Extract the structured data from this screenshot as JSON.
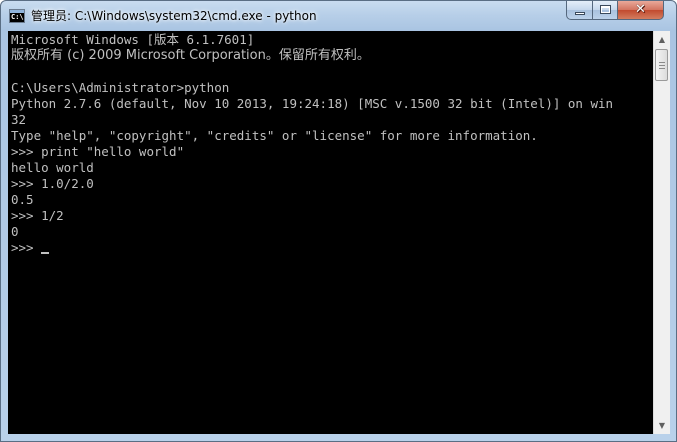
{
  "window": {
    "title": "管理员: C:\\Windows\\system32\\cmd.exe - python",
    "app_icon_text": "C:\\"
  },
  "caption_buttons": {
    "close_glyph": "✕"
  },
  "console": {
    "lines": [
      "Microsoft Windows [版本 6.1.7601]",
      "版权所有 (c) 2009 Microsoft Corporation。保留所有权利。",
      "",
      "C:\\Users\\Administrator>python",
      "Python 2.7.6 (default, Nov 10 2013, 19:24:18) [MSC v.1500 32 bit (Intel)] on win",
      "32",
      "Type \"help\", \"copyright\", \"credits\" or \"license\" for more information.",
      ">>> print \"hello world\"",
      "hello world",
      ">>> 1.0/2.0",
      "0.5",
      ">>> 1/2",
      "0",
      ">>> "
    ],
    "colors": {
      "background": "#000000",
      "foreground": "#c0c0c0"
    }
  },
  "scrollbar": {
    "up_arrow": "▲",
    "down_arrow": "▼"
  }
}
